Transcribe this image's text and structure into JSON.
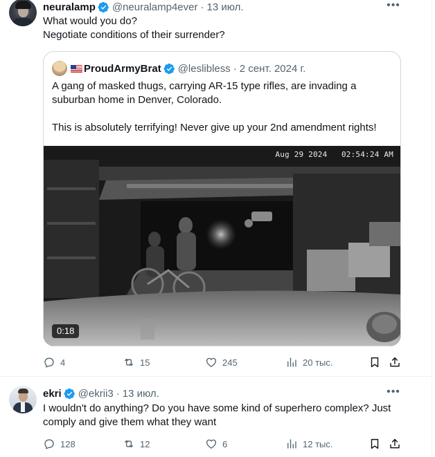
{
  "tweets": [
    {
      "author_name": "neuralamp",
      "author_handle": "@neuralamp4ever",
      "date": "13 июл.",
      "text_lines": [
        "What would you do?",
        "Negotiate conditions of their surrender?"
      ],
      "quoted": {
        "author_name": "ProudArmyBrat",
        "author_handle": "@leslibless",
        "date": "2 сент. 2024 г.",
        "paragraphs": [
          "A gang of masked thugs, carrying AR-15 type rifles, are invading a suburban home in Denver, Colorado.",
          "This is absolutely terrifying! Never give up your 2nd amendment rights!"
        ],
        "video": {
          "overlay_date": "Aug 29 2024",
          "overlay_time": "02:54:24 AM",
          "duration": "0:18"
        }
      },
      "stats": {
        "replies": "4",
        "reposts": "15",
        "likes": "245",
        "views": "20 тыс."
      }
    },
    {
      "author_name": "ekri",
      "author_handle": "@ekrii3",
      "date": "13 июл.",
      "text": "I wouldn't do anything? Do you have some kind of superhero complex? Just comply and give them what they want",
      "stats": {
        "replies": "128",
        "reposts": "12",
        "likes": "6",
        "views": "12 тыс."
      }
    }
  ],
  "icons": {
    "verified": "verified-badge-icon",
    "more": "more-options-icon",
    "reply": "reply-icon",
    "repost": "repost-icon",
    "like": "like-icon",
    "views": "views-icon",
    "bookmark": "bookmark-icon",
    "share": "share-icon",
    "flag": "us-flag-icon"
  },
  "colors": {
    "text": "#0f1419",
    "secondary": "#536471",
    "verified": "#1d9bf0",
    "border": "#cfd9de",
    "divider": "#eff3f4"
  }
}
